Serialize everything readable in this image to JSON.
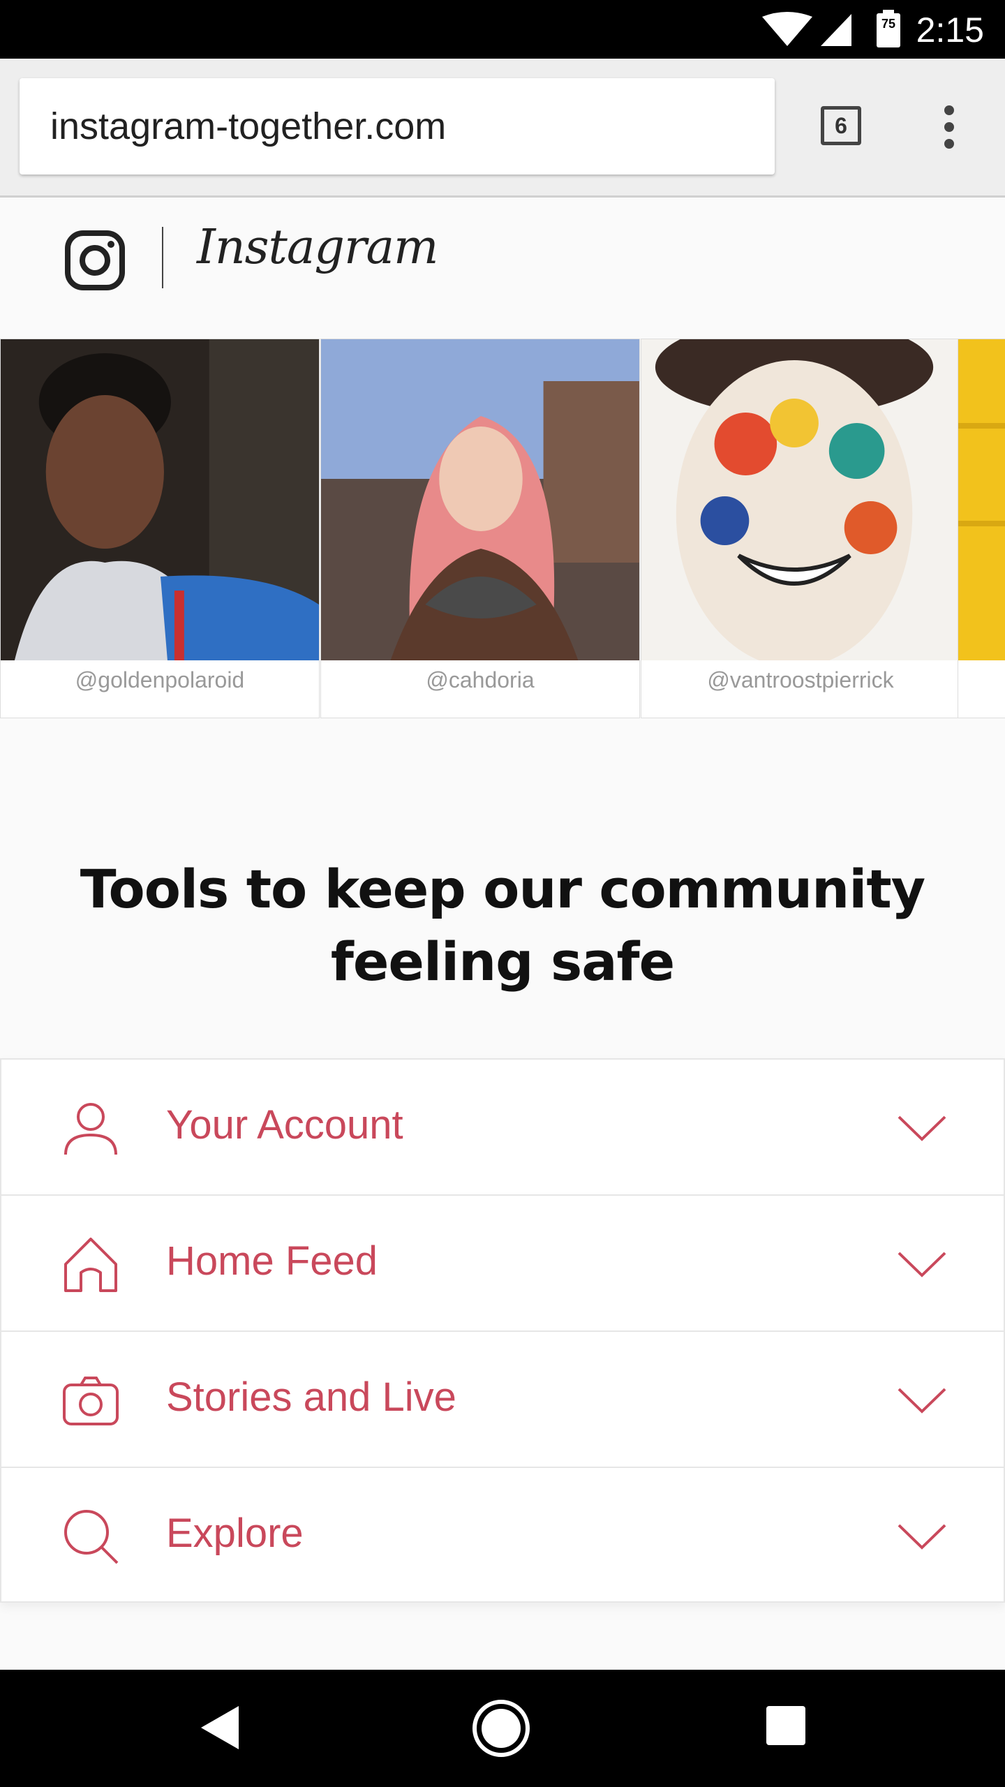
{
  "status_bar": {
    "time": "2:15",
    "battery_level": "75",
    "icons": [
      "wifi-icon",
      "signal-icon",
      "battery-icon"
    ]
  },
  "browser": {
    "url": "instagram-together.com",
    "tab_count": "6"
  },
  "header": {
    "wordmark": "Instagram"
  },
  "carousel": {
    "cards": [
      {
        "handle": "@goldenpolaroid"
      },
      {
        "handle": "@cahdoria"
      },
      {
        "handle": "@vantroostpierrick"
      },
      {
        "handle": ""
      }
    ]
  },
  "main": {
    "heading": "Tools to keep our community feeling safe",
    "accordion": [
      {
        "label": "Your Account",
        "icon": "person-icon"
      },
      {
        "label": "Home Feed",
        "icon": "home-icon"
      },
      {
        "label": "Stories and Live",
        "icon": "camera-icon"
      },
      {
        "label": "Explore",
        "icon": "search-icon"
      }
    ]
  },
  "colors": {
    "accent": "#c9485b",
    "background": "#fafafa"
  }
}
